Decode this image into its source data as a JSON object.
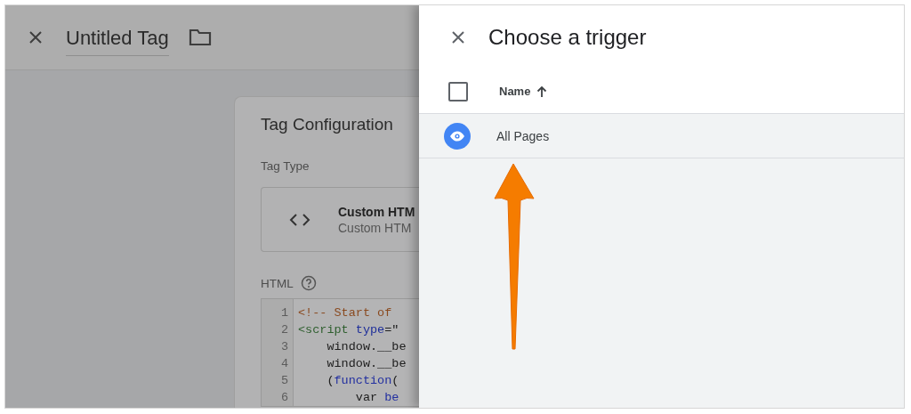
{
  "editor": {
    "title": "Untitled Tag",
    "card": {
      "title": "Tag Configuration",
      "tag_type_label": "Tag Type",
      "tag_type": {
        "name": "Custom HTM",
        "description": "Custom HTM"
      },
      "html_label": "HTML",
      "code_lines": [
        {
          "number": "1",
          "segments": [
            {
              "kind": "comment",
              "text": "<!-- Start of"
            }
          ]
        },
        {
          "number": "2",
          "segments": [
            {
              "kind": "tag",
              "text": "<script"
            },
            {
              "kind": "attribute",
              "text": " type"
            },
            {
              "kind": "plain",
              "text": "=\""
            }
          ]
        },
        {
          "number": "3",
          "segments": [
            {
              "kind": "plain",
              "text": "    window.__be"
            }
          ]
        },
        {
          "number": "4",
          "segments": [
            {
              "kind": "plain",
              "text": "    window.__be"
            }
          ]
        },
        {
          "number": "5",
          "segments": [
            {
              "kind": "plain",
              "text": "    ("
            },
            {
              "kind": "keyword",
              "text": "function"
            },
            {
              "kind": "plain",
              "text": "("
            }
          ]
        },
        {
          "number": "6",
          "segments": [
            {
              "kind": "plain",
              "text": "        var "
            },
            {
              "kind": "keyword",
              "text": "be"
            }
          ]
        }
      ]
    }
  },
  "trigger_panel": {
    "title": "Choose a trigger",
    "select_all_checked": false,
    "columns": [
      {
        "label": "Name",
        "sort_ascending": true
      }
    ],
    "rows": [
      {
        "name": "All Pages"
      }
    ]
  }
}
